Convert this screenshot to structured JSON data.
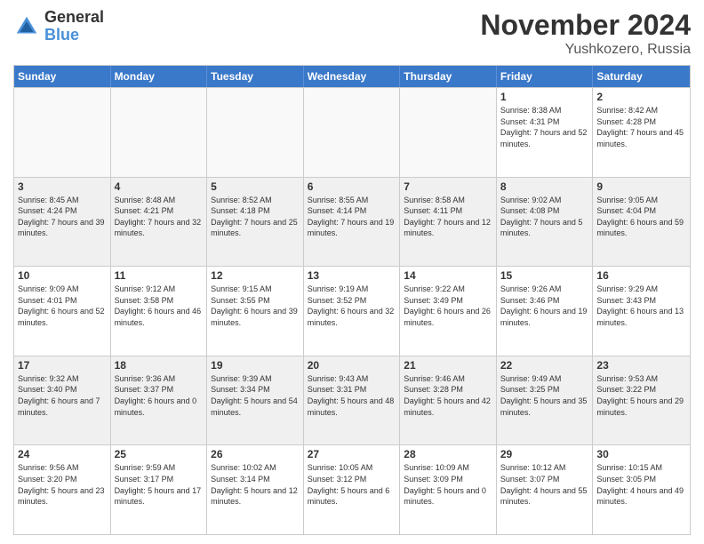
{
  "logo": {
    "general": "General",
    "blue": "Blue"
  },
  "title": "November 2024",
  "subtitle": "Yushkozero, Russia",
  "days_of_week": [
    "Sunday",
    "Monday",
    "Tuesday",
    "Wednesday",
    "Thursday",
    "Friday",
    "Saturday"
  ],
  "weeks": [
    [
      {
        "day": "",
        "info": ""
      },
      {
        "day": "",
        "info": ""
      },
      {
        "day": "",
        "info": ""
      },
      {
        "day": "",
        "info": ""
      },
      {
        "day": "",
        "info": ""
      },
      {
        "day": "1",
        "info": "Sunrise: 8:38 AM\nSunset: 4:31 PM\nDaylight: 7 hours\nand 52 minutes."
      },
      {
        "day": "2",
        "info": "Sunrise: 8:42 AM\nSunset: 4:28 PM\nDaylight: 7 hours\nand 45 minutes."
      }
    ],
    [
      {
        "day": "3",
        "info": "Sunrise: 8:45 AM\nSunset: 4:24 PM\nDaylight: 7 hours\nand 39 minutes."
      },
      {
        "day": "4",
        "info": "Sunrise: 8:48 AM\nSunset: 4:21 PM\nDaylight: 7 hours\nand 32 minutes."
      },
      {
        "day": "5",
        "info": "Sunrise: 8:52 AM\nSunset: 4:18 PM\nDaylight: 7 hours\nand 25 minutes."
      },
      {
        "day": "6",
        "info": "Sunrise: 8:55 AM\nSunset: 4:14 PM\nDaylight: 7 hours\nand 19 minutes."
      },
      {
        "day": "7",
        "info": "Sunrise: 8:58 AM\nSunset: 4:11 PM\nDaylight: 7 hours\nand 12 minutes."
      },
      {
        "day": "8",
        "info": "Sunrise: 9:02 AM\nSunset: 4:08 PM\nDaylight: 7 hours\nand 5 minutes."
      },
      {
        "day": "9",
        "info": "Sunrise: 9:05 AM\nSunset: 4:04 PM\nDaylight: 6 hours\nand 59 minutes."
      }
    ],
    [
      {
        "day": "10",
        "info": "Sunrise: 9:09 AM\nSunset: 4:01 PM\nDaylight: 6 hours\nand 52 minutes."
      },
      {
        "day": "11",
        "info": "Sunrise: 9:12 AM\nSunset: 3:58 PM\nDaylight: 6 hours\nand 46 minutes."
      },
      {
        "day": "12",
        "info": "Sunrise: 9:15 AM\nSunset: 3:55 PM\nDaylight: 6 hours\nand 39 minutes."
      },
      {
        "day": "13",
        "info": "Sunrise: 9:19 AM\nSunset: 3:52 PM\nDaylight: 6 hours\nand 32 minutes."
      },
      {
        "day": "14",
        "info": "Sunrise: 9:22 AM\nSunset: 3:49 PM\nDaylight: 6 hours\nand 26 minutes."
      },
      {
        "day": "15",
        "info": "Sunrise: 9:26 AM\nSunset: 3:46 PM\nDaylight: 6 hours\nand 19 minutes."
      },
      {
        "day": "16",
        "info": "Sunrise: 9:29 AM\nSunset: 3:43 PM\nDaylight: 6 hours\nand 13 minutes."
      }
    ],
    [
      {
        "day": "17",
        "info": "Sunrise: 9:32 AM\nSunset: 3:40 PM\nDaylight: 6 hours\nand 7 minutes."
      },
      {
        "day": "18",
        "info": "Sunrise: 9:36 AM\nSunset: 3:37 PM\nDaylight: 6 hours\nand 0 minutes."
      },
      {
        "day": "19",
        "info": "Sunrise: 9:39 AM\nSunset: 3:34 PM\nDaylight: 5 hours\nand 54 minutes."
      },
      {
        "day": "20",
        "info": "Sunrise: 9:43 AM\nSunset: 3:31 PM\nDaylight: 5 hours\nand 48 minutes."
      },
      {
        "day": "21",
        "info": "Sunrise: 9:46 AM\nSunset: 3:28 PM\nDaylight: 5 hours\nand 42 minutes."
      },
      {
        "day": "22",
        "info": "Sunrise: 9:49 AM\nSunset: 3:25 PM\nDaylight: 5 hours\nand 35 minutes."
      },
      {
        "day": "23",
        "info": "Sunrise: 9:53 AM\nSunset: 3:22 PM\nDaylight: 5 hours\nand 29 minutes."
      }
    ],
    [
      {
        "day": "24",
        "info": "Sunrise: 9:56 AM\nSunset: 3:20 PM\nDaylight: 5 hours\nand 23 minutes."
      },
      {
        "day": "25",
        "info": "Sunrise: 9:59 AM\nSunset: 3:17 PM\nDaylight: 5 hours\nand 17 minutes."
      },
      {
        "day": "26",
        "info": "Sunrise: 10:02 AM\nSunset: 3:14 PM\nDaylight: 5 hours\nand 12 minutes."
      },
      {
        "day": "27",
        "info": "Sunrise: 10:05 AM\nSunset: 3:12 PM\nDaylight: 5 hours\nand 6 minutes."
      },
      {
        "day": "28",
        "info": "Sunrise: 10:09 AM\nSunset: 3:09 PM\nDaylight: 5 hours\nand 0 minutes."
      },
      {
        "day": "29",
        "info": "Sunrise: 10:12 AM\nSunset: 3:07 PM\nDaylight: 4 hours\nand 55 minutes."
      },
      {
        "day": "30",
        "info": "Sunrise: 10:15 AM\nSunset: 3:05 PM\nDaylight: 4 hours\nand 49 minutes."
      }
    ]
  ]
}
